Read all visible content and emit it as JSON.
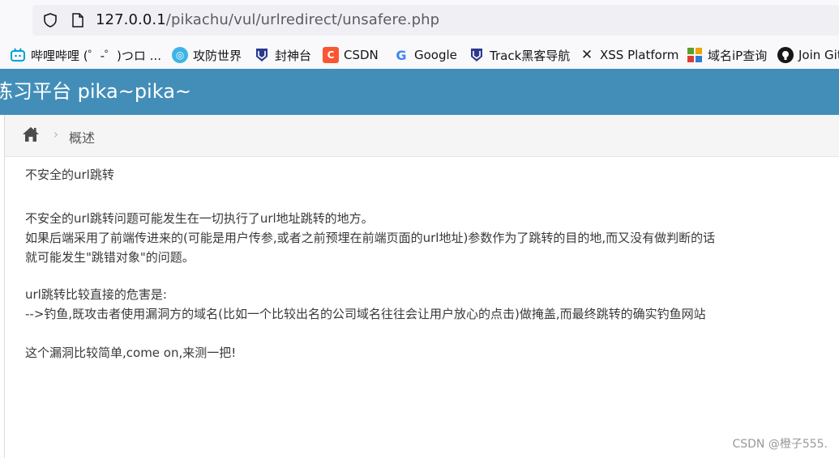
{
  "browser": {
    "url_host": "127.0.0.1",
    "url_path": "/pikachu/vul/urlredirect/unsafere.php"
  },
  "bookmarks": [
    {
      "label": "哔哩哔哩 (゜-゜)つロ ...",
      "icon": "bilibili-icon",
      "color": "#00a1d6"
    },
    {
      "label": "攻防世界",
      "icon": "adworld-icon",
      "color": "#3cb4e7"
    },
    {
      "label": "封神台",
      "icon": "fengshentai-icon",
      "color": "#2b3a8f"
    },
    {
      "label": "CSDN",
      "icon": "csdn-icon",
      "color": "#fc5531"
    },
    {
      "label": "Google",
      "icon": "google-icon",
      "color": "#4285f4"
    },
    {
      "label": "Track黑客导航",
      "icon": "track-icon",
      "color": "#2b3a8f"
    },
    {
      "label": "XSS Platform",
      "icon": "xss-icon",
      "color": "#333333"
    },
    {
      "label": "域名iP查询",
      "icon": "domain-query-icon",
      "color": "#5aa02c"
    },
    {
      "label": "Join Git",
      "icon": "github-icon",
      "color": "#181717"
    }
  ],
  "header": {
    "title": "练习平台 pika~pika~",
    "bg_color": "#438eb9"
  },
  "breadcrumb": {
    "separator": "›",
    "current": "概述"
  },
  "content": {
    "heading": "不安全的url跳转",
    "para1_line1": "不安全的url跳转问题可能发生在一切执行了url地址跳转的地方。",
    "para1_line2": "如果后端采用了前端传进来的(可能是用户传参,或者之前预埋在前端页面的url地址)参数作为了跳转的目的地,而又没有做判断的话",
    "para1_line3": "就可能发生\"跳错对象\"的问题。",
    "para2_line1": "url跳转比较直接的危害是:",
    "para2_line2": "-->钓鱼,既攻击者使用漏洞方的域名(比如一个比较出名的公司域名往往会让用户放心的点击)做掩盖,而最终跳转的确实钓鱼网站",
    "para3": "这个漏洞比较简单,come on,来测一把!"
  },
  "watermark": "CSDN @橙子555."
}
